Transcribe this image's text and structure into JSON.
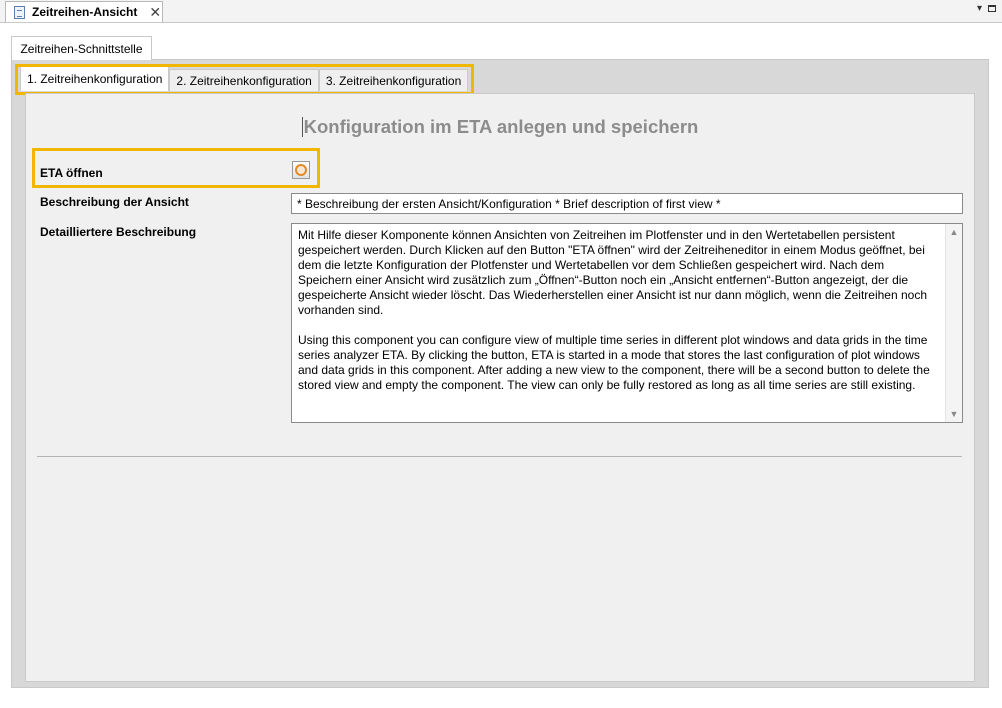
{
  "editor": {
    "tab_title": "Zeitreihen-Ansicht",
    "close_glyph": "✕",
    "menu_glyph": "▾"
  },
  "outer_tab": {
    "label": "Zeitreihen-Schnittstelle"
  },
  "inner_tabs": [
    {
      "label": "1. Zeitreihenkonfiguration",
      "active": true
    },
    {
      "label": "2. Zeitreihenkonfiguration",
      "active": false
    },
    {
      "label": "3. Zeitreihenkonfiguration",
      "active": false
    }
  ],
  "content": {
    "title": "Konfiguration im ETA anlegen und speichern",
    "eta_label": "ETA öffnen",
    "description_label": "Beschreibung der Ansicht",
    "description_value": "* Beschreibung der ersten Ansicht/Konfiguration * Brief description of first view *",
    "detail_label": "Detailliertere Beschreibung",
    "detail_de": "Mit Hilfe dieser Komponente können Ansichten von Zeitreihen im Plotfenster und in den Wertetabellen persistent gespeichert werden. Durch Klicken auf den Button \"ETA öffnen\" wird der Zeitreiheneditor in einem Modus geöffnet, bei dem die letzte Konfiguration der Plotfenster und Wertetabellen vor dem Schließen gespeichert wird. Nach dem Speichern einer Ansicht wird zusätzlich zum „Öffnen“-Button noch ein „Ansicht entfernen“-Button angezeigt, der die gespeicherte Ansicht wieder löscht. Das Wiederherstellen einer Ansicht ist nur dann möglich, wenn die Zeitreihen noch vorhanden sind.",
    "detail_en": "Using this component you can configure view of multiple time series in different plot windows and data grids in the time series analyzer ETA. By clicking the button, ETA is started in a mode that stores the last configuration of plot windows and data grids in this component. After adding a new view to the component, there will be a second button to delete the stored view and empty the component. The view can only be fully restored as long as all time series are still existing."
  },
  "colors": {
    "highlight": "#f1b700",
    "title_gray": "#8c8c8c",
    "eta_orange": "#e08a2c"
  },
  "icons": {
    "editor_tab": "document-icon",
    "eta_button": "eta-logo-icon",
    "scroll_up": "chevron-up-icon",
    "scroll_down": "chevron-down-icon"
  }
}
